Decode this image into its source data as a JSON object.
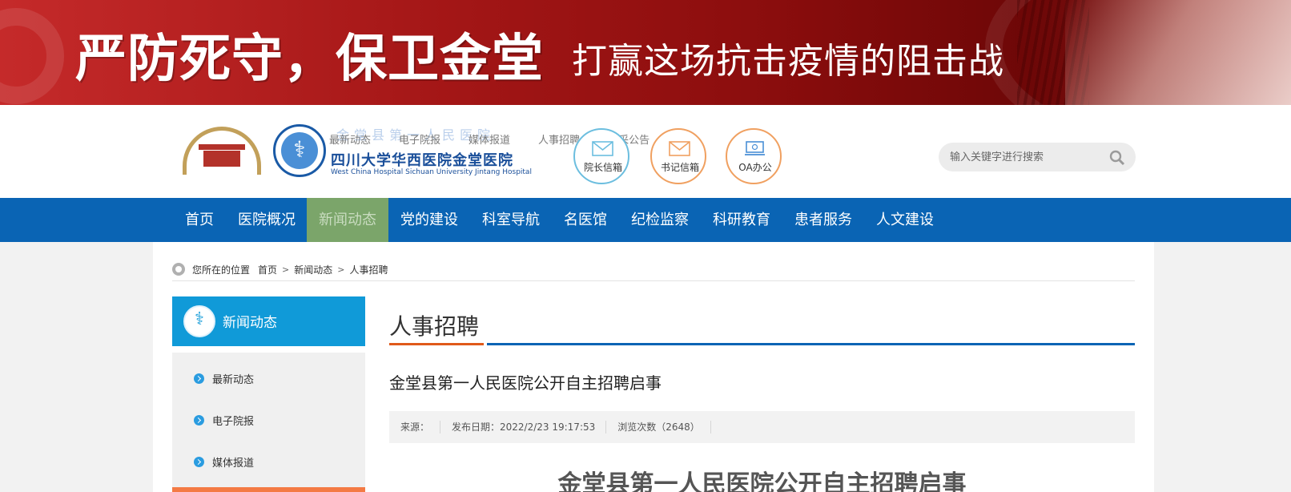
{
  "banner": {
    "main_text": "严防死守，保卫金堂",
    "sub_text": "打赢这场抗击疫情的阻击战"
  },
  "header": {
    "hospital_name_cn": "四川大学华西医院金堂医院",
    "hospital_name_en": "West China Hospital Sichuan University Jintang Hospital",
    "hospital_name_faint": "金堂县第一人民医院",
    "top_links": [
      "最新动态",
      "电子院报",
      "媒体报道",
      "人事招聘",
      "招采公告"
    ],
    "quick_links": [
      {
        "label": "院长信箱",
        "icon": "mail-icon"
      },
      {
        "label": "书记信箱",
        "icon": "mail-icon"
      },
      {
        "label": "OA办公",
        "icon": "computer-icon"
      }
    ],
    "search": {
      "placeholder": "输入关键字进行搜索"
    }
  },
  "nav": {
    "items": [
      "首页",
      "医院概况",
      "新闻动态",
      "党的建设",
      "科室导航",
      "名医馆",
      "纪检监察",
      "科研教育",
      "患者服务",
      "人文建设"
    ],
    "active": "新闻动态"
  },
  "breadcrumb": {
    "prefix": "您所在的位置",
    "items": [
      "首页",
      "新闻动态",
      "人事招聘"
    ],
    "separator": ">"
  },
  "sidebar": {
    "title": "新闻动态",
    "items": [
      "最新动态",
      "电子院报",
      "媒体报道"
    ]
  },
  "section": {
    "title": "人事招聘"
  },
  "article": {
    "title": "金堂县第一人民医院公开自主招聘启事",
    "source": "来源：",
    "date": "发布日期：2022/2/23 19:17:53",
    "views": "浏览次数（2648）",
    "heading": "金堂县第一人民医院公开自主招聘启事"
  },
  "colors": {
    "nav_bg": "#0a64b4",
    "nav_active": "#7ba56a",
    "sidebar_head": "#109ad8",
    "accent_orange": "#e05a1a",
    "banner_red": "#a31616"
  }
}
